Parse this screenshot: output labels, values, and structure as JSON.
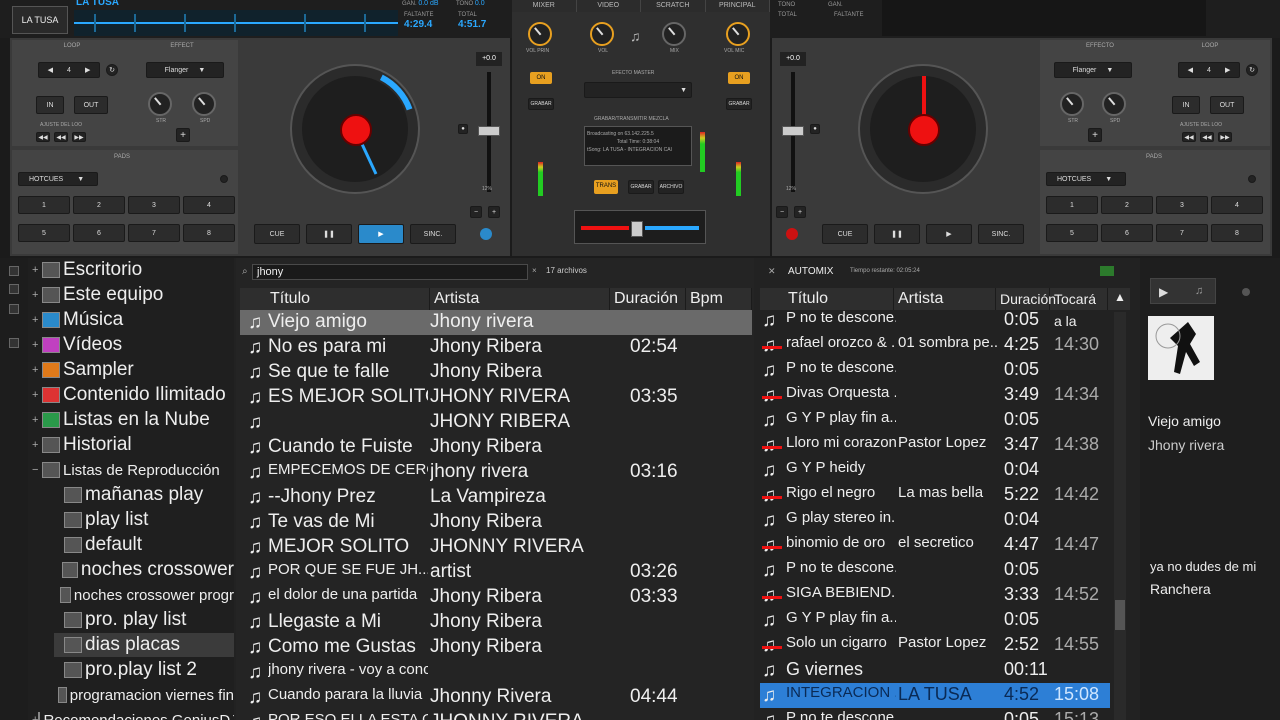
{
  "deck_left": {
    "title": "LA TUSA",
    "logo": "LA TUSA",
    "gain_label": "GAN.",
    "gain_value": "0.0 dB",
    "tone_label": "TONO",
    "tone_value": "0.0",
    "elapsed_label": "FALTANTE",
    "elapsed_value": "4:29.4",
    "total_label": "TOTAL",
    "total_value": "4:51.7",
    "loop_label": "LOOP",
    "effect_label": "EFFECT",
    "loop_value": "4",
    "effect_value": "Flanger",
    "in_label": "IN",
    "out_label": "OUT",
    "adjust_label": "AJUSTE DEL LOO",
    "str_label": "STR",
    "spd_label": "SPD",
    "pads_label": "PADS",
    "hotcues_label": "HOTCUES",
    "pads": [
      "1",
      "2",
      "3",
      "4",
      "5",
      "6",
      "7",
      "8"
    ],
    "pitch_value": "+0.0",
    "pitch_range": "12%",
    "cue_label": "CUE",
    "sync_label": "SINC.",
    "pause_icon": "pause-icon",
    "play_icon": "play-icon",
    "play_active": true,
    "rotation_value": 0.75
  },
  "deck_right": {
    "tone_label": "TONO",
    "gain_label": "GAN.",
    "elapsed_label": "FALTANTE",
    "total_label": "TOTAL",
    "loop_label": "LOOP",
    "effect_label": "EFFECTO",
    "loop_value": "4",
    "effect_value": "Flanger",
    "in_label": "IN",
    "out_label": "OUT",
    "adjust_label": "AJUSTE DEL LOO",
    "str_label": "STR",
    "spd_label": "SPD",
    "pads_label": "PADS",
    "hotcues_label": "HOTCUES",
    "pads": [
      "1",
      "2",
      "3",
      "4",
      "5",
      "6",
      "7",
      "8"
    ],
    "pitch_value": "+0.0",
    "pitch_range": "12%",
    "cue_label": "CUE",
    "sync_label": "SINC."
  },
  "mixer": {
    "tabs": [
      "MIXER",
      "VIDEO",
      "SCRATCH",
      "PRINCIPAL"
    ],
    "vol_left_label": "VOL PRIN",
    "vol_label": "VOL",
    "mic_label": "MIX",
    "vol_right_label": "VOL MIC",
    "on_label": "ON",
    "record_label": "GRABAR",
    "efecto_master_label": "EFECTO MASTER",
    "broadcast_label": "GRABAR/TRANSMITIR MEZCLA",
    "broadcast_lines": [
      "Broadcasting on 63.142.225.5",
      "Total Time: 0:38:04",
      "tSong: LA TUSA - INTEGRACION CAI"
    ],
    "trans_label": "TRANS",
    "grabar_label": "GRABAR",
    "archivo_label": "ARCHIVO"
  },
  "browser": {
    "side_icons": [
      "deck-icon",
      "sampler-icon",
      "list-icon",
      "loop-icon"
    ],
    "tree": [
      {
        "label": "Escritorio",
        "icon": "desktop-icon",
        "expand": "+",
        "indent": 0
      },
      {
        "label": "Este equipo",
        "icon": "computer-icon",
        "expand": "+",
        "indent": 0
      },
      {
        "label": "Música",
        "icon": "music-folder-icon",
        "expand": "+",
        "indent": 0
      },
      {
        "label": "Vídeos",
        "icon": "video-folder-icon",
        "expand": "+",
        "indent": 0
      },
      {
        "label": "Sampler",
        "icon": "sampler-icon",
        "expand": "+",
        "indent": 0
      },
      {
        "label": "Contenido Ilimitado",
        "icon": "content-icon",
        "expand": "+",
        "indent": 0
      },
      {
        "label": "Listas en la Nube",
        "icon": "cloud-icon",
        "expand": "+",
        "indent": 0
      },
      {
        "label": "Historial",
        "icon": "history-icon",
        "expand": "+",
        "indent": 0
      },
      {
        "label": "Listas de Reproducción",
        "icon": "playlist-icon",
        "expand": "−",
        "indent": 0
      },
      {
        "label": "mañanas play",
        "icon": "playlist-icon",
        "expand": "",
        "indent": 1
      },
      {
        "label": "play list",
        "icon": "playlist-icon",
        "expand": "",
        "indent": 1
      },
      {
        "label": "default",
        "icon": "playlist-icon",
        "expand": "",
        "indent": 1
      },
      {
        "label": "noches crossower",
        "icon": "playlist-icon",
        "expand": "",
        "indent": 1
      },
      {
        "label": "noches crossower progr",
        "icon": "playlist-icon",
        "expand": "",
        "indent": 1
      },
      {
        "label": "pro. play list",
        "icon": "playlist-icon",
        "expand": "",
        "indent": 1
      },
      {
        "label": "dias placas",
        "icon": "playlist-icon",
        "expand": "",
        "indent": 1,
        "selected": true
      },
      {
        "label": "pro.play list 2",
        "icon": "playlist-icon",
        "expand": "",
        "indent": 1
      },
      {
        "label": "programacion viernes fin",
        "icon": "playlist-icon",
        "expand": "",
        "indent": 1
      },
      {
        "label": "Recomendaciones GeniusDJ",
        "icon": "genius-icon",
        "expand": "+",
        "indent": 0
      }
    ],
    "search_value": "jhony",
    "file_count": "17 archivos",
    "columns": [
      "Título",
      "Artista",
      "Duración",
      "Bpm"
    ],
    "files": [
      {
        "title": "Viejo amigo",
        "artist": "Jhony rivera",
        "duration": "",
        "selected": true
      },
      {
        "title": "No es para mi",
        "artist": "Jhony Ribera",
        "duration": "02:54"
      },
      {
        "title": "Se que te falle",
        "artist": "Jhony Ribera",
        "duration": ""
      },
      {
        "title": "ES MEJOR SOLITO",
        "artist": "JHONY RIVERA",
        "duration": "03:35"
      },
      {
        "title": "",
        "artist": "JHONY RIBERA",
        "duration": ""
      },
      {
        "title": "Cuando te Fuiste",
        "artist": "Jhony Ribera",
        "duration": ""
      },
      {
        "title": "EMPECEMOS DE CERO",
        "artist": "jhony rivera",
        "duration": "03:16"
      },
      {
        "title": "--Jhony Prez",
        "artist": "La Vampireza",
        "duration": ""
      },
      {
        "title": "Te vas de Mi",
        "artist": "Jhony Ribera",
        "duration": ""
      },
      {
        "title": "MEJOR SOLITO",
        "artist": "JHONNY RIVERA",
        "duration": ""
      },
      {
        "title": "POR QUE SE FUE     JH...",
        "artist": "artist",
        "duration": "03:26"
      },
      {
        "title": "el dolor de una partida",
        "artist": "Jhony Ribera",
        "duration": "03:33"
      },
      {
        "title": "Llegaste a Mi",
        "artist": "Jhony Ribera",
        "duration": ""
      },
      {
        "title": "Como me Gustas",
        "artist": "Jhony Ribera",
        "duration": ""
      },
      {
        "title": "jhony rivera - voy a conc...",
        "artist": "",
        "duration": ""
      },
      {
        "title": "Cuando parara la lluvia",
        "artist": "Jhonny Rivera",
        "duration": "04:44"
      },
      {
        "title": "POR ESO ELLA ESTA C",
        "artist": "JHONNY RIVERA",
        "duration": ""
      }
    ],
    "automix": {
      "title": "AUTOMIX",
      "remaining_label": "Tiempo restante: 02:05:24",
      "columns": [
        "Título",
        "Artista",
        "Duración",
        "Tocará a la"
      ],
      "rows": [
        {
          "title": "P no te descone...",
          "artist": "",
          "duration": "0:05",
          "time": "",
          "mark": false
        },
        {
          "title": "rafael orozco & ...",
          "artist": "01 sombra pe...",
          "duration": "4:25",
          "time": "14:30",
          "mark": true
        },
        {
          "title": "P no te descone...",
          "artist": "",
          "duration": "0:05",
          "time": "",
          "mark": false
        },
        {
          "title": "Divas Orquesta ...",
          "artist": "",
          "duration": "3:49",
          "time": "14:34",
          "mark": true
        },
        {
          "title": "G Y P play fin a...",
          "artist": "",
          "duration": "0:05",
          "time": "",
          "mark": false
        },
        {
          "title": "Lloro mi corazon",
          "artist": "Pastor Lopez",
          "duration": "3:47",
          "time": "14:38",
          "mark": true
        },
        {
          "title": "G Y P heidy",
          "artist": "",
          "duration": "0:04",
          "time": "",
          "mark": false
        },
        {
          "title": "Rigo el negro",
          "artist": "La mas bella",
          "duration": "5:22",
          "time": "14:42",
          "mark": true
        },
        {
          "title": "G play stereo in...",
          "artist": "",
          "duration": "0:04",
          "time": "",
          "mark": false
        },
        {
          "title": "binomio de oro",
          "artist": "el secretico",
          "duration": "4:47",
          "time": "14:47",
          "mark": true
        },
        {
          "title": "P no te descone...",
          "artist": "",
          "duration": "0:05",
          "time": "",
          "mark": false
        },
        {
          "title": "SIGA BEBIEND...",
          "artist": "",
          "duration": "3:33",
          "time": "14:52",
          "mark": true
        },
        {
          "title": "G Y P play fin a...",
          "artist": "",
          "duration": "0:05",
          "time": "",
          "mark": false
        },
        {
          "title": "Solo un cigarro",
          "artist": "Pastor Lopez",
          "duration": "2:52",
          "time": "14:55",
          "mark": true
        },
        {
          "title": "G viernes",
          "artist": "",
          "duration": "00:11",
          "time": "",
          "mark": false
        },
        {
          "title": "INTEGRACION ...",
          "artist": "LA TUSA",
          "duration": "4:52",
          "time": "15:08",
          "mark": false,
          "playing": true
        },
        {
          "title": "P no te descone...",
          "artist": "",
          "duration": "0:05",
          "time": "15:13",
          "mark": false
        }
      ]
    },
    "info": {
      "song_title": "Viejo amigo",
      "song_artist": "Jhony rivera",
      "comment": "ya no dudes de mi",
      "genre": "Ranchera"
    }
  }
}
